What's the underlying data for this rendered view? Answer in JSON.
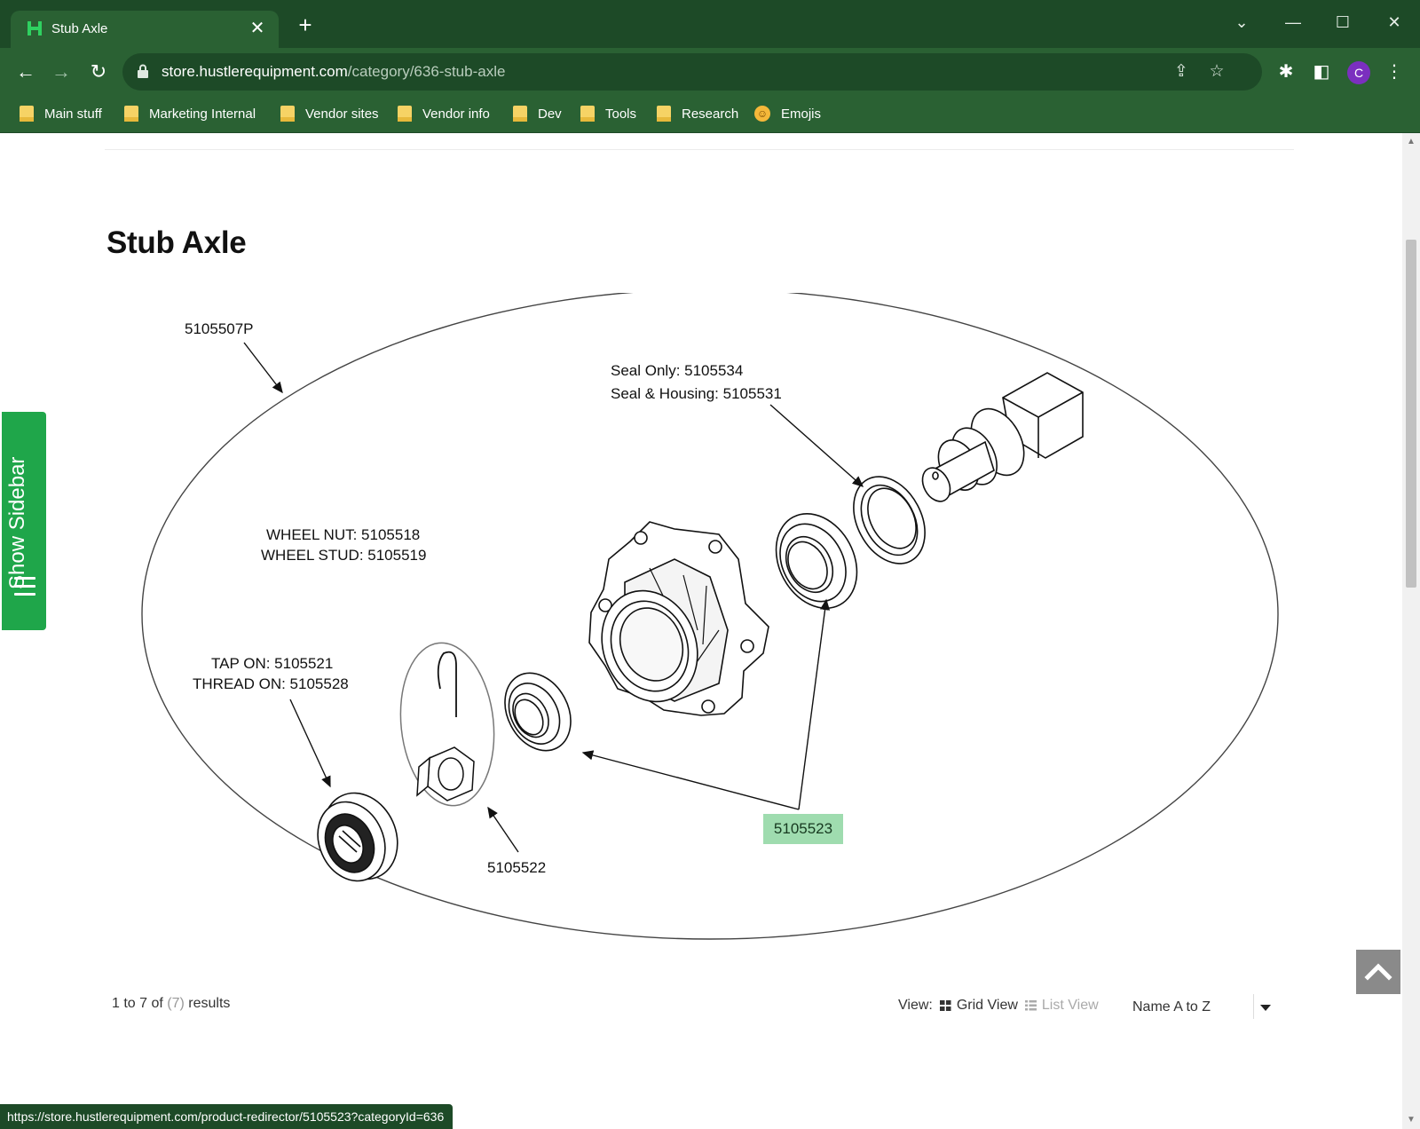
{
  "browser": {
    "tab_title": "Stub Axle",
    "tab_favicon": "H",
    "tab_close": "✕",
    "new_tab": "+",
    "url_host": "store.hustlerequipment.com",
    "url_path": "/category/636-stub-axle",
    "profile_initial": "C",
    "bookmarks": [
      "Main stuff",
      "Marketing Internal",
      "Vendor sites",
      "Vendor info",
      "Dev",
      "Tools",
      "Research",
      "Emojis"
    ],
    "status_url": "https://store.hustlerequipment.com/product-redirector/5105523?categoryId=636"
  },
  "colors": {
    "chrome_dark": "#1d4a27",
    "chrome": "#2a6133",
    "sidebar_green": "#1fa64a",
    "part_highlight": "#9fdcaf"
  },
  "page": {
    "title": "Stub Axle",
    "sidebar_toggle": "Show Sidebar",
    "results_prefix": "1 to 7 of",
    "results_count": "(7)",
    "results_suffix": "results",
    "view_label": "View:",
    "grid_view": "Grid View",
    "list_view": "List View",
    "sort_value": "Name A to Z"
  },
  "diagram": {
    "assembly": "5105507P",
    "seal_only": "Seal Only: 5105534",
    "seal_housing": "Seal & Housing: 5105531",
    "wheel_nut": "WHEEL NUT: 5105518",
    "wheel_stud": "WHEEL STUD: 5105519",
    "tap_on": "TAP ON: 5105521",
    "thread_on": "THREAD ON: 5105528",
    "cotter_nut": "5105522",
    "bearing": "5105523"
  }
}
